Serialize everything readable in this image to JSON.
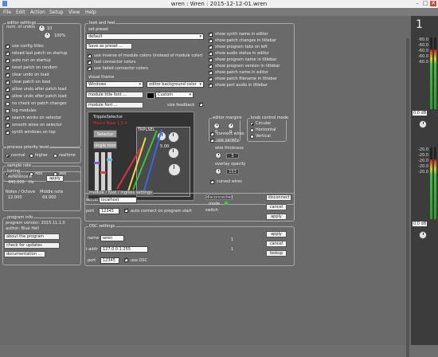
{
  "window": {
    "title": "wren : Wren : 2015-12-12-01.wren",
    "controls": [
      "–",
      "□",
      "✕"
    ]
  },
  "menu": [
    "File",
    "Edit",
    "Action",
    "Setup",
    "View",
    "Help"
  ],
  "editor_settings": {
    "legend": "editor settings",
    "undo_label": "num. of undos",
    "undo_value": "10",
    "zoom_value": "100%",
    "checks": [
      {
        "label": "use config titles",
        "on": true
      },
      {
        "label": "reload last patch on startup",
        "on": true
      },
      {
        "label": "auto run on startup",
        "on": true
      },
      {
        "label": "reset patch on random",
        "on": true
      },
      {
        "label": "clear undo on load",
        "on": true
      },
      {
        "label": "clear patch on load",
        "on": true
      },
      {
        "label": "allow undo after patch load",
        "on": true
      },
      {
        "label": "allow undo after patch load",
        "on": false
      },
      {
        "label": "no check on patch changes",
        "on": false
      },
      {
        "label": "log modules",
        "on": false
      },
      {
        "label": "search works on selector",
        "on": true
      },
      {
        "label": "smooth wires on selector",
        "on": true
      },
      {
        "label": "synth windows on top",
        "on": true
      }
    ]
  },
  "process_priority": {
    "legend": "process priority level",
    "options": [
      "normal",
      "higher",
      "realtime"
    ],
    "selected": 0
  },
  "sample_rate": {
    "legend": "sample rate",
    "options": [
      "44k1",
      "48k",
      "96k"
    ],
    "selected": 0
  },
  "tuning": {
    "legend": "tuning",
    "ref_label": "Reference A",
    "ref_value": "440.000",
    "ref_unit": "Hz",
    "apply": "apply",
    "n_oct_label": "Notes / Octave",
    "n_oct_value": "12.000",
    "middle_label": "Middle note",
    "middle_value": "69.000"
  },
  "program_info": {
    "legend": "program info",
    "version": "program version: 2015.11.1.0",
    "author": "author: Blue Hell",
    "about": "about the program",
    "check_updates": "check for updates",
    "docs": "documentation ..."
  },
  "look_and_feel": {
    "legend": "look and feel",
    "set_preset_label": "set preset",
    "preset_value": "default",
    "save_preset": "Save as preset ...",
    "preset_checks": [
      {
        "label": "use inverse of module colors (instead of module color)",
        "on": true
      },
      {
        "label": "fast connector colors",
        "on": true
      },
      {
        "label": "use faded connector colors",
        "on": true
      }
    ],
    "visual_theme_label": "visual theme",
    "theme_value": "Windows",
    "color_select": "editor background color",
    "module_title_font": "module title font ...",
    "module_font": "module font ...",
    "color_value": "Custom",
    "size_label": "size feedback",
    "right_checks": [
      {
        "label": "show synth name in editor",
        "on": true
      },
      {
        "label": "show patch changes in titlebar",
        "on": true
      },
      {
        "label": "show program tabs on left",
        "on": true
      },
      {
        "label": "show audio status in editor",
        "on": true
      },
      {
        "label": "show program name in titlebar",
        "on": true
      },
      {
        "label": "show program version in titlebar",
        "on": true
      },
      {
        "label": "show patch name in editor",
        "on": true
      },
      {
        "label": "show patch filename in titlebar",
        "on": true
      },
      {
        "label": "show port audio in titlebar",
        "on": true
      }
    ],
    "editor_margins": {
      "legend": "editor margins",
      "h_value": "0",
      "v_value": "0",
      "h_label": "horizontal",
      "v_label": "vertical"
    },
    "module_control": {
      "legend": "knob control mode",
      "options": [
        "Circular",
        "Horizontal",
        "Vertical"
      ],
      "selected": 0
    },
    "wire_checks": [
      {
        "label": "connect wires",
        "on": true
      },
      {
        "label": "use variety",
        "on": true
      }
    ],
    "wire_thickness_label": "wire thickness",
    "wire_thickness_value": "3",
    "overlay_opacity_label": "overlay opacity",
    "overlay_opacity_value": "153",
    "curved_wires": {
      "label": "curved wires",
      "on": true
    },
    "preview": {
      "title": "TrippleSelector",
      "sub1": "Macro Bass 1.5.4",
      "sel": "Selector",
      "sel2": "single mon",
      "meter_val": "5.00",
      "tag": "TRPLSEL"
    }
  },
  "remote": {
    "legend": "module / host / ingress settings",
    "server_label": "server",
    "server_value": "localhost",
    "port_label": "port",
    "port_value": "12345",
    "port_check": {
      "label": "auto connect on program start",
      "on": true
    },
    "status_label": "disconnected",
    "mode_label": "mode",
    "switch_label": "switch",
    "btn1": "disconnect",
    "btn2": "cancel",
    "btn3": "apply"
  },
  "osc": {
    "legend": "OSC settings",
    "name_label": "name",
    "name_value": "wren",
    "addr_label": "i-addr",
    "addr_value": "127.0.0.1:255",
    "port_label": "port",
    "port_value": "12345",
    "osc_check": {
      "label": "use OSC",
      "on": true
    },
    "btn1": "apply",
    "btn2": "cancel",
    "btn3": "lookup",
    "val1": "1",
    "val2": "1"
  },
  "side": {
    "channel": "1",
    "top_values": [
      "-60.0",
      "-60.0",
      "-60.0",
      "-60.0",
      "-60.0"
    ],
    "top_db": "0.0 dB",
    "mid_values": [
      "-20.0",
      "-20.0",
      "-20.0",
      "-20.0",
      "-20.0"
    ],
    "mid_db": "0.0 dB"
  }
}
